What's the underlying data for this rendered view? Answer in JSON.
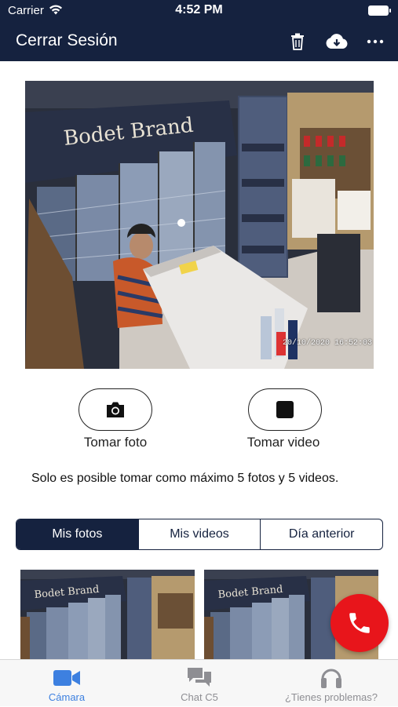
{
  "status_bar": {
    "carrier": "Carrier",
    "time": "4:52 PM"
  },
  "nav": {
    "title": "Cerrar Sesión",
    "icons": [
      "trash-icon",
      "cloud-download-icon",
      "more-icon"
    ]
  },
  "camera": {
    "timestamp": "20/10/2020 16:52:03",
    "signage": "Bodet Brand"
  },
  "actions": {
    "photo_label": "Tomar foto",
    "video_label": "Tomar video"
  },
  "info_text": "Solo es posible tomar como máximo 5 fotos y 5 videos.",
  "tabs": [
    {
      "label": "Mis fotos",
      "active": true
    },
    {
      "label": "Mis videos",
      "active": false
    },
    {
      "label": "Día anterior",
      "active": false
    }
  ],
  "tab_bar": [
    {
      "label": "Cámara",
      "icon": "video-camera-icon",
      "active": true
    },
    {
      "label": "Chat C5",
      "icon": "chat-icon",
      "active": false
    },
    {
      "label": "¿Tienes problemas?",
      "icon": "headset-icon",
      "active": false
    }
  ],
  "colors": {
    "navy": "#15223f",
    "red": "#e8151b",
    "blue": "#3d80e0",
    "gray": "#8e8e93"
  }
}
